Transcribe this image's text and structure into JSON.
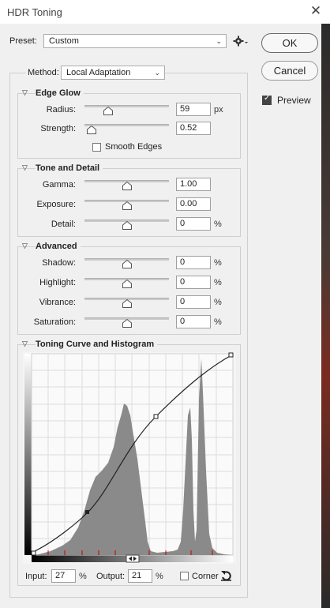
{
  "window": {
    "title": "HDR Toning",
    "close_glyph": "✕"
  },
  "preset": {
    "label": "Preset:",
    "value": "Custom",
    "menu_icon": "gear-icon"
  },
  "buttons": {
    "ok": "OK",
    "cancel": "Cancel"
  },
  "preview": {
    "label": "Preview",
    "checked": true
  },
  "method": {
    "label": "Method:",
    "value": "Local Adaptation"
  },
  "edge_glow": {
    "title": "Edge Glow",
    "radius": {
      "label": "Radius:",
      "value": "59",
      "unit": "px",
      "pos": 0.28
    },
    "strength": {
      "label": "Strength:",
      "value": "0.52",
      "unit": "",
      "pos": 0.08
    },
    "smooth_edges": {
      "label": "Smooth Edges",
      "checked": false
    }
  },
  "tone_detail": {
    "title": "Tone and Detail",
    "gamma": {
      "label": "Gamma:",
      "value": "1.00",
      "unit": "",
      "pos": 0.5
    },
    "exposure": {
      "label": "Exposure:",
      "value": "0.00",
      "unit": "",
      "pos": 0.5
    },
    "detail": {
      "label": "Detail:",
      "value": "0",
      "unit": "%",
      "pos": 0.5
    }
  },
  "advanced": {
    "title": "Advanced",
    "shadow": {
      "label": "Shadow:",
      "value": "0",
      "unit": "%",
      "pos": 0.5
    },
    "highlight": {
      "label": "Highlight:",
      "value": "0",
      "unit": "%",
      "pos": 0.5
    },
    "vibrance": {
      "label": "Vibrance:",
      "value": "0",
      "unit": "%",
      "pos": 0.5
    },
    "saturation": {
      "label": "Saturation:",
      "value": "0",
      "unit": "%",
      "pos": 0.5
    }
  },
  "toning_curve": {
    "title": "Toning Curve and Histogram",
    "input_label": "Input:",
    "input_value": "27",
    "input_unit": "%",
    "output_label": "Output:",
    "output_value": "21",
    "output_unit": "%",
    "corner_label": "Corner",
    "corner_checked": false,
    "reset_icon": "reset-icon"
  }
}
